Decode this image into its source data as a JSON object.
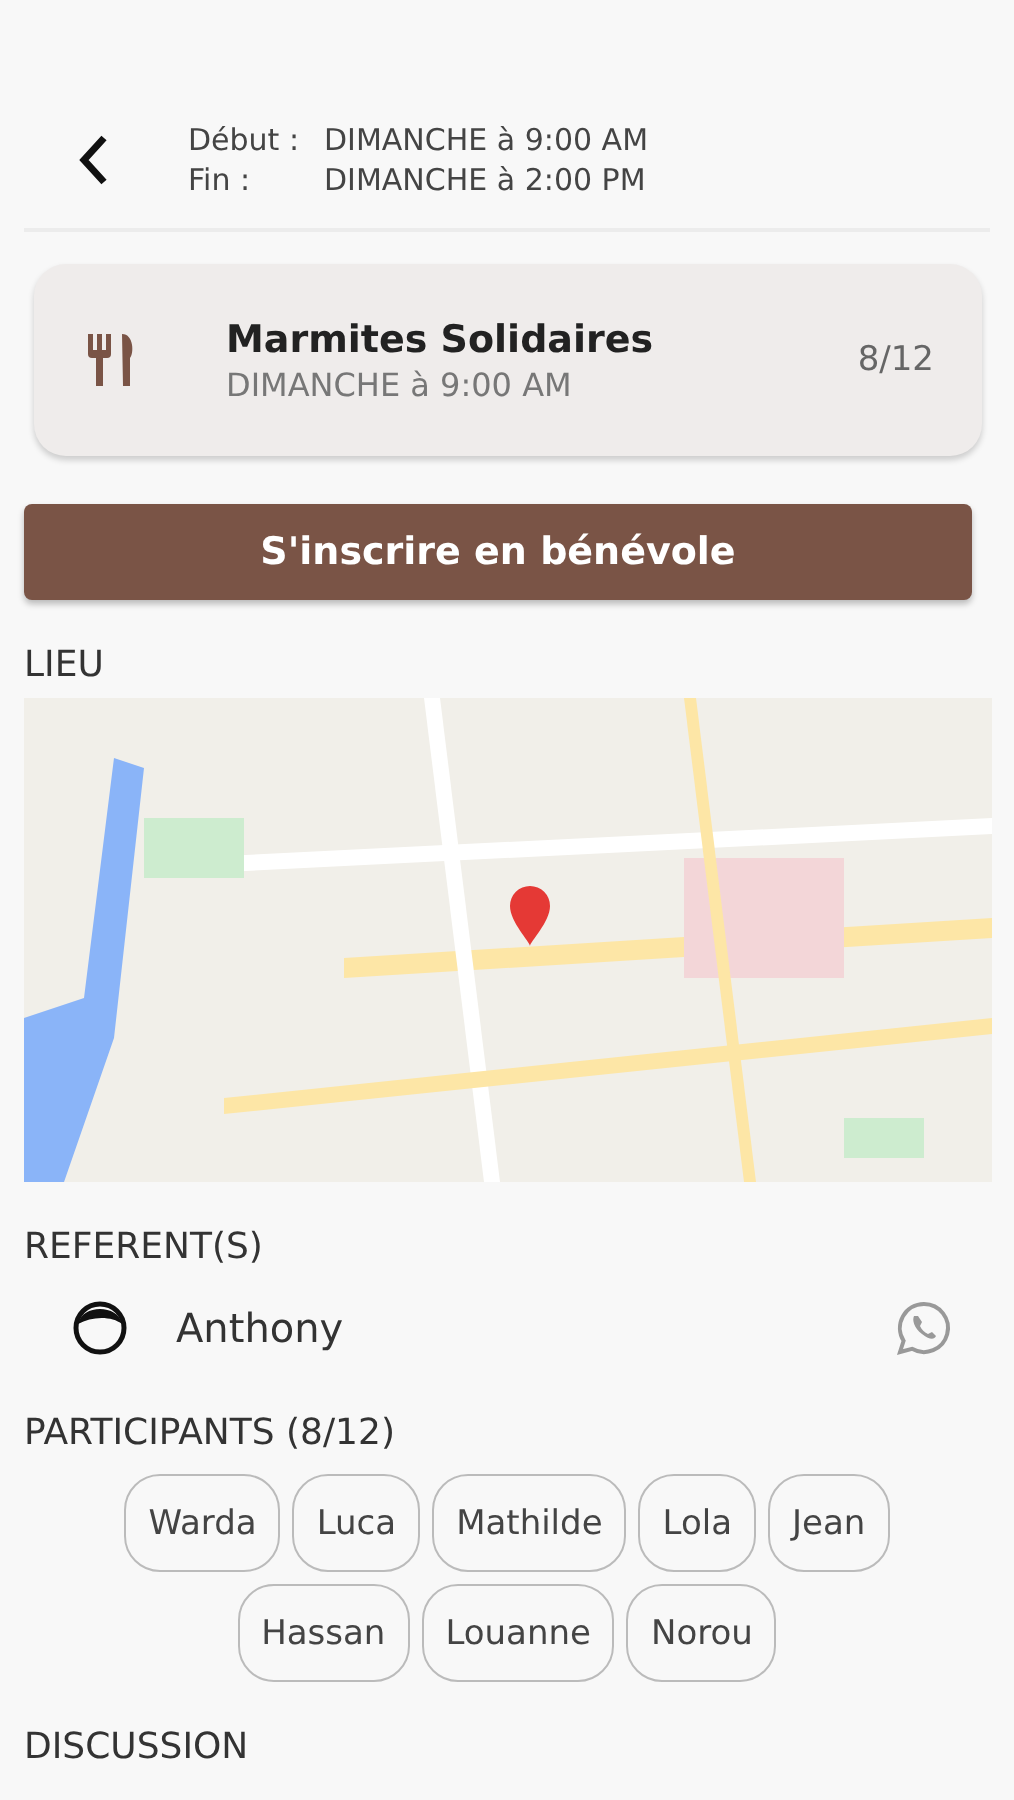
{
  "header": {
    "rows": [
      {
        "label": "Début :",
        "value": "DIMANCHE à 9:00 AM"
      },
      {
        "label": "Fin :",
        "value": "DIMANCHE à 2:00 PM"
      }
    ]
  },
  "event": {
    "title": "Marmites Solidaires",
    "subtitle": "DIMANCHE à 9:00 AM",
    "count": "8/12"
  },
  "register_button": "S'inscrire en bénévole",
  "location": {
    "heading": "LIEU"
  },
  "referents": {
    "heading": "REFERENT(S)",
    "people": [
      {
        "name": "Anthony"
      }
    ]
  },
  "participants": {
    "heading": "PARTICIPANTS (8/12)",
    "names": [
      "Warda",
      "Luca",
      "Mathilde",
      "Lola",
      "Jean",
      "Hassan",
      "Louanne",
      "Norou"
    ]
  },
  "discussion": {
    "heading": "DISCUSSION"
  }
}
